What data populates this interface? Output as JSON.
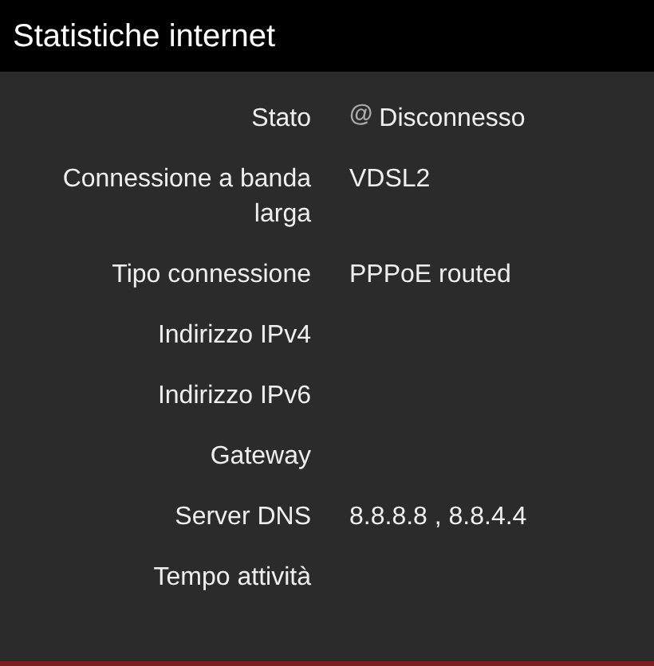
{
  "header": {
    "title": "Statistiche internet"
  },
  "rows": [
    {
      "label": "Stato",
      "icon": "@",
      "value": "Disconnesso"
    },
    {
      "label": "Connessione a banda larga",
      "value": "VDSL2"
    },
    {
      "label": "Tipo connessione",
      "value": "PPPoE routed"
    },
    {
      "label": "Indirizzo IPv4"
    },
    {
      "label": "Indirizzo IPv6"
    },
    {
      "label": "Gateway"
    },
    {
      "label": "Server DNS",
      "value": "8.8.8.8 , 8.8.4.4"
    },
    {
      "label": "Tempo attività"
    }
  ]
}
